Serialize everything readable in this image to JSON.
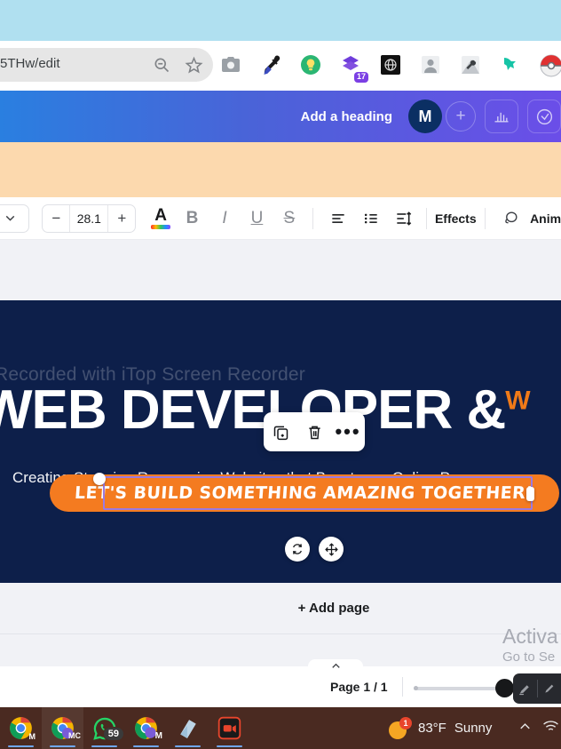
{
  "browser": {
    "url_fragment": "5THw/edit",
    "omnibox_icons": [
      "zoom-out-icon",
      "bookmark-star-icon"
    ],
    "extensions": [
      {
        "name": "camera-extension-icon"
      },
      {
        "name": "eyedropper-extension-icon"
      },
      {
        "name": "lightbulb-extension-icon"
      },
      {
        "name": "purple-stack-extension-icon",
        "badge": "17"
      },
      {
        "name": "dark-globe-extension-icon"
      },
      {
        "name": "person-extension-icon"
      },
      {
        "name": "wrench-extension-icon"
      },
      {
        "name": "teal-bird-extension-icon"
      },
      {
        "name": "pokeball-profile-icon"
      }
    ]
  },
  "app_header": {
    "title": "Add a heading",
    "avatar_initial": "M",
    "add_collaborator_label": "+",
    "buttons": [
      "analytics-icon",
      "timer-icon"
    ]
  },
  "edit_toolbar": {
    "font_caret": "chevron-down-icon",
    "decrease_label": "−",
    "font_size": "28.1",
    "increase_label": "+",
    "text_color_letter": "A",
    "bold_label": "B",
    "italic_label": "I",
    "underline_label": "U",
    "strikethrough_label": "S",
    "align_icon": "align-left-icon",
    "list_icon": "bullet-list-icon",
    "spacing_icon": "line-spacing-icon",
    "effects_label": "Effects",
    "animate_label": "Anim"
  },
  "canvas": {
    "watermark": "Recorded with iTop Screen Recorder",
    "headline": "WEB DEVELOPER &",
    "headline_accent": "W",
    "subline": "Creating Stunning Responsive Websites that Boost your Online Presence.",
    "cta_text": "LET'S BUILD SOMETHING AMAZING TOGETHER!",
    "float_toolbar": [
      "duplicate-icon",
      "trash-icon",
      "more-options-icon"
    ],
    "handles": [
      "rotate-handle-icon",
      "move-handle-icon"
    ],
    "colors": {
      "background": "#0d1f4a",
      "cta_background": "#f47b20",
      "accent": "#f07a18",
      "selection_outline": "#9b7ae0"
    }
  },
  "add_page": {
    "label": "+ Add page"
  },
  "activate_watermark": {
    "line1": "Activa",
    "line2": "Go to Se"
  },
  "status_bar": {
    "collapse_caret": "chevron-up-icon",
    "page_label": "Page 1 / 1",
    "zoom_tools": [
      "highlighter-icon",
      "pen-icon"
    ]
  },
  "taskbar": {
    "items": [
      {
        "name": "chrome-window-1",
        "initial": "M",
        "badge": null
      },
      {
        "name": "chrome-window-2",
        "initial": "MC",
        "badge": null
      },
      {
        "name": "whatsapp",
        "initial": "",
        "badge": "59"
      },
      {
        "name": "chrome-window-3",
        "initial": "M",
        "badge": null
      },
      {
        "name": "notepad",
        "initial": "",
        "badge": null
      },
      {
        "name": "itop-screen-recorder",
        "initial": "",
        "badge": null
      }
    ],
    "weather": {
      "temperature": "83°F",
      "condition": "Sunny",
      "alert_count": "1"
    },
    "tray_icons": [
      "chevron-up-icon",
      "wifi-icon"
    ]
  }
}
